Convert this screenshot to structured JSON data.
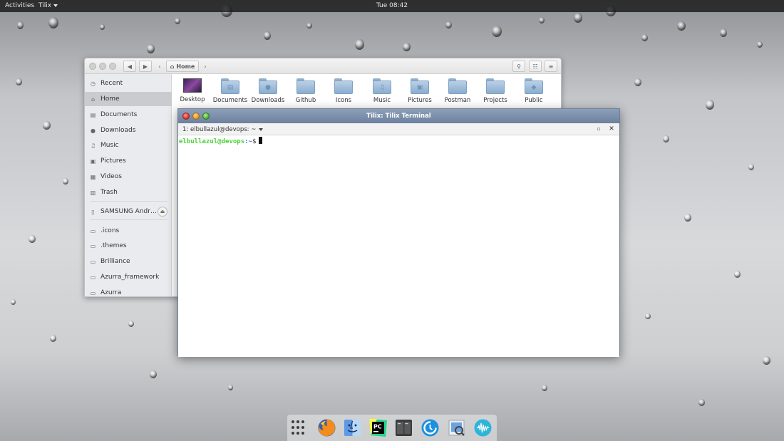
{
  "top_bar": {
    "activities": "Activities",
    "app_menu": "Tilix",
    "clock": "Tue 08:42"
  },
  "files": {
    "path_button": "Home",
    "sidebar": [
      {
        "label": "Recent",
        "icon": "clock-icon"
      },
      {
        "label": "Home",
        "icon": "home-icon",
        "active": true
      },
      {
        "label": "Documents",
        "icon": "document-icon"
      },
      {
        "label": "Downloads",
        "icon": "download-icon"
      },
      {
        "label": "Music",
        "icon": "music-note-icon"
      },
      {
        "label": "Pictures",
        "icon": "camera-icon"
      },
      {
        "label": "Videos",
        "icon": "film-icon"
      },
      {
        "label": "Trash",
        "icon": "trash-icon"
      },
      {
        "label": "SAMSUNG Andr…",
        "icon": "phone-icon"
      },
      {
        "label": ".icons",
        "icon": "drive-icon"
      },
      {
        "label": ".themes",
        "icon": "drive-icon"
      },
      {
        "label": "Brilliance",
        "icon": "drive-icon"
      },
      {
        "label": "Azurra_framework",
        "icon": "drive-icon"
      },
      {
        "label": "Azurra",
        "icon": "drive-icon"
      }
    ],
    "folders": [
      {
        "label": "Desktop",
        "icon": "desktop-folder-icon"
      },
      {
        "label": "Documents",
        "icon": "documents-folder-icon"
      },
      {
        "label": "Downloads",
        "icon": "downloads-folder-icon"
      },
      {
        "label": "Github",
        "icon": "github-folder-icon"
      },
      {
        "label": "Icons",
        "icon": "icons-folder-icon"
      },
      {
        "label": "Music",
        "icon": "music-folder-icon"
      },
      {
        "label": "Pictures",
        "icon": "pictures-folder-icon"
      },
      {
        "label": "Postman",
        "icon": "postman-folder-icon"
      },
      {
        "label": "Projects",
        "icon": "projects-folder-icon"
      },
      {
        "label": "Public",
        "icon": "public-folder-icon"
      }
    ]
  },
  "terminal": {
    "title": "Tilix: Tilix Terminal",
    "session_title": "1: elbullazul@devops: ~",
    "prompt_user": "elbullazul@devops",
    "prompt_path": ":~",
    "prompt_symbol": "$"
  },
  "dock": {
    "items": [
      "show-apps",
      "firefox",
      "finder",
      "pycharm",
      "tilix",
      "timeshift",
      "preview",
      "audio-wave"
    ]
  },
  "colors": {
    "prompt_user": "#4cd23a",
    "prompt_path": "#3a7bd5",
    "terminal_titlebar": "#7a8dab"
  }
}
